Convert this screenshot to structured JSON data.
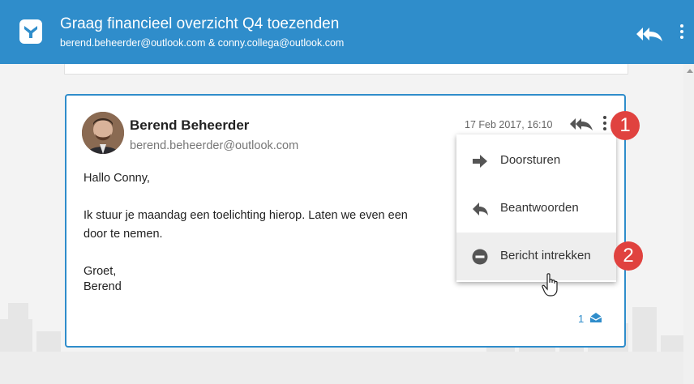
{
  "header": {
    "title": "Graag financieel overzicht Q4 toezenden",
    "participants": "berend.beheerder@outlook.com & conny.collega@outlook.com",
    "reply_all_icon": "reply-all-icon",
    "more_icon": "more-vertical-icon"
  },
  "message": {
    "sender_name": "Berend Beheerder",
    "sender_email": "berend.beheerder@outlook.com",
    "date": "17 Feb 2017, 16:10",
    "body": [
      "Hallo Conny,",
      "Ik stuur je maandag een toelichting hierop. Laten we even een",
      "door te nemen.",
      "Groet,",
      "Berend"
    ],
    "read_count": "1"
  },
  "menu": {
    "items": [
      {
        "label": "Doorsturen",
        "icon": "forward-arrow-icon"
      },
      {
        "label": "Beantwoorden",
        "icon": "reply-arrow-icon"
      },
      {
        "label": "Bericht intrekken",
        "icon": "minus-circle-icon"
      }
    ]
  },
  "badges": {
    "one": "1",
    "two": "2"
  },
  "colors": {
    "header": "#2f8dcb",
    "badge": "#e0423f",
    "card_border": "#2f8dcb"
  }
}
